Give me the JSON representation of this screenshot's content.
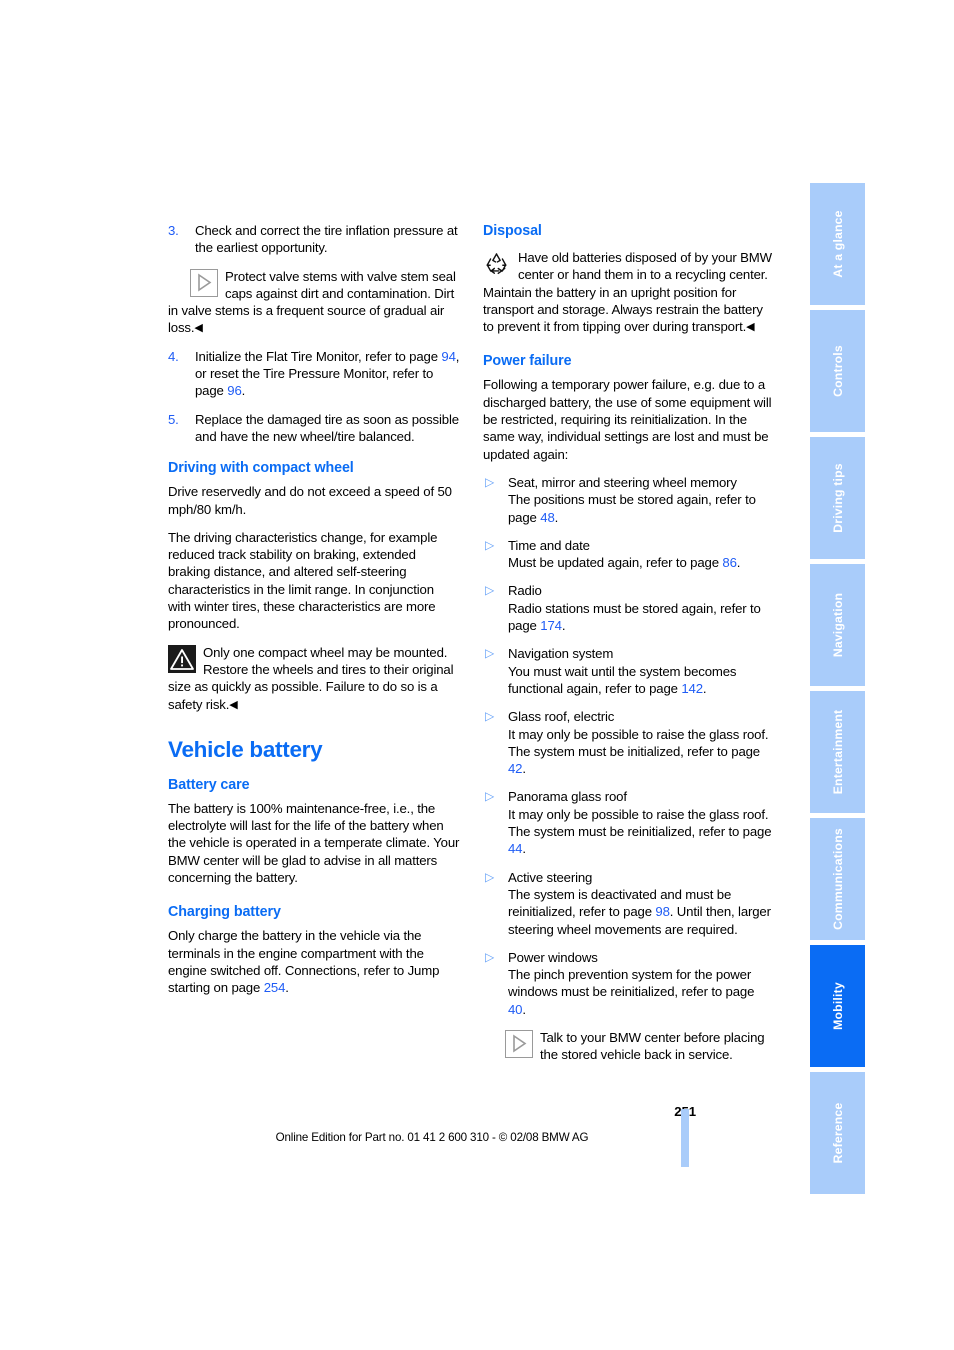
{
  "document": {
    "page_number": "251",
    "footer_text": "Online Edition for Part no. 01 41 2 600 310 - © 02/08 BMW AG"
  },
  "colors": {
    "heading_blue": "#0a6cf4",
    "reference_blue": "#1f5cf5",
    "tab_inactive": "#a9ccfa",
    "tab_active": "#0a6cf4",
    "bullet_blue": "#63a0f7"
  },
  "left_column": {
    "numbered_steps": [
      {
        "number": "3.",
        "text": "Check and correct the tire inflation pressure at the earliest opportunity."
      },
      {
        "number": "4.",
        "text_before": "Initialize the Flat Tire Monitor, refer to page ",
        "ref1": "94",
        "text_middle": ", or reset the Tire Pressure Monitor, refer to page ",
        "ref2": "96",
        "text_after": "."
      },
      {
        "number": "5.",
        "text": "Replace the damaged tire as soon as possible and have the new wheel/tire balanced."
      }
    ],
    "valve_note": {
      "icon": "hint-triangle-icon",
      "text": "Protect valve stems with valve stem seal caps against dirt and contamination. Dirt in valve stems is a frequent source of gradual air loss.",
      "endmark": "◀"
    },
    "compact_wheel": {
      "heading": "Driving with compact wheel",
      "paragraph1": "Drive reservedly and do not exceed a speed of 50 mph/80 km/h.",
      "paragraph2": "The driving characteristics change, for example reduced track stability on braking, extended braking distance, and altered self-steering characteristics in the limit range. In conjunction with winter tires, these characteristics are more pronounced.",
      "warning": {
        "icon": "warning-triangle-icon",
        "text": "Only one compact wheel may be mounted. Restore the wheels and tires to their original size as quickly as possible. Failure to do so is a safety risk.",
        "endmark": "◀"
      }
    },
    "vehicle_battery": {
      "heading": "Vehicle battery",
      "battery_care": {
        "heading": "Battery care",
        "text": "The battery is 100% maintenance-free, i.e., the electrolyte will last for the life of the battery when the vehicle is operated in a temperate climate. Your BMW center will be glad to advise in all matters concerning the battery."
      },
      "charging_battery": {
        "heading": "Charging battery",
        "text_before": "Only charge the battery in the vehicle via the terminals in the engine compartment with the engine switched off. Connections, refer to Jump starting on page ",
        "ref": "254",
        "text_after": "."
      }
    }
  },
  "right_column": {
    "disposal": {
      "heading": "Disposal",
      "icon": "recycle-icon",
      "text": "Have old batteries disposed of by your BMW center or hand them in to a recycling center. Maintain the battery in an upright position for transport and storage. Always restrain the battery to prevent it from tipping over during transport.",
      "endmark": "◀"
    },
    "power_failure": {
      "heading": "Power failure",
      "intro": "Following a temporary power failure, e.g. due to a discharged battery, the use of some equipment will be restricted, requiring its reinitialization. In the same way, individual settings are lost and must be updated again:",
      "items": [
        {
          "title": "Seat, mirror and steering wheel memory",
          "text_before": "The positions must be stored again, refer to page ",
          "ref": "48",
          "text_after": "."
        },
        {
          "title": "Time and date",
          "text_before": "Must be updated again, refer to page ",
          "ref": "86",
          "text_after": "."
        },
        {
          "title": "Radio",
          "text_before": "Radio stations must be stored again, refer to page ",
          "ref": "174",
          "text_after": "."
        },
        {
          "title": "Navigation system",
          "text_before": "You must wait until the system becomes functional again, refer to page ",
          "ref": "142",
          "text_after": "."
        },
        {
          "title": "Glass roof, electric",
          "text_before": "It may only be possible to raise the glass roof. The system must be initialized, refer to page ",
          "ref": "42",
          "text_after": "."
        },
        {
          "title": "Panorama glass roof",
          "text_before": "It may only be possible to raise the glass roof. The system must be reinitialized, refer to page ",
          "ref": "44",
          "text_after": "."
        },
        {
          "title": "Active steering",
          "text_before": "The system is deactivated and must be reinitialized, refer to page ",
          "ref": "98",
          "text_after": ". Until then, larger steering wheel movements are required."
        },
        {
          "title": "Power windows",
          "text_before": "The pinch prevention system for the power windows must be reinitialized, refer to page ",
          "ref": "40",
          "text_after": "."
        }
      ],
      "closing_note": {
        "icon": "hint-triangle-icon",
        "text": "Talk to your BMW center before placing the stored vehicle back in service."
      }
    }
  },
  "tab_rail": {
    "tabs": [
      {
        "label": "At a glance",
        "active": false
      },
      {
        "label": "Controls",
        "active": false
      },
      {
        "label": "Driving tips",
        "active": false
      },
      {
        "label": "Navigation",
        "active": false
      },
      {
        "label": "Entertainment",
        "active": false
      },
      {
        "label": "Communications",
        "active": false
      },
      {
        "label": "Mobility",
        "active": true
      },
      {
        "label": "Reference",
        "active": false
      }
    ]
  }
}
